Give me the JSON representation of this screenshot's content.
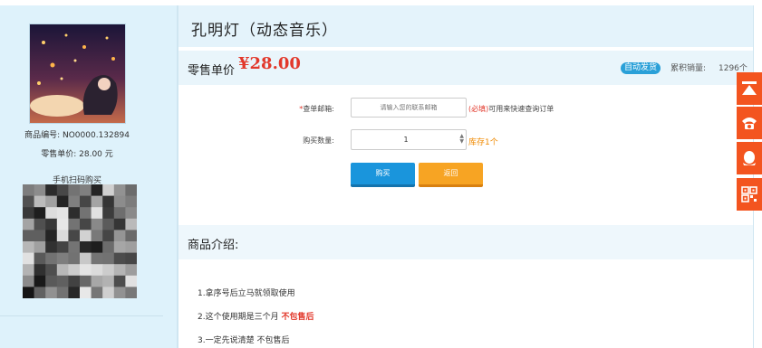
{
  "sidebar": {
    "sku_label": "商品编号:",
    "sku_value": "NO0000.132894",
    "price_label": "零售单价:",
    "price_value": "28.00 元",
    "scan_label": "手机扫码购买"
  },
  "product": {
    "title": "孔明灯（动态音乐）",
    "price_label": "零售单价",
    "price": "¥28.00",
    "auto_delivery_badge": "自动发货",
    "sales_label": "累积销量:",
    "sales_value": "1296个"
  },
  "form": {
    "email_label": "查单邮箱:",
    "email_placeholder": "请输入您的联系邮箱",
    "email_hint_required": "(必填)",
    "email_hint_text": "可用来快速查询订单",
    "qty_label": "购买数量:",
    "qty_value": "1",
    "stock_text": "库存1个",
    "buy_button": "购买",
    "back_button": "返回"
  },
  "intro": {
    "title": "商品介绍:",
    "lines": [
      {
        "text": "1.拿序号后立马就领取使用",
        "red": ""
      },
      {
        "text": "2.这个使用期是三个月",
        "red": "不包售后"
      },
      {
        "text": "3.一定先说清楚 不包售后",
        "red": ""
      }
    ]
  },
  "side_buttons": [
    {
      "icon": "back-to-top-icon"
    },
    {
      "icon": "phone-icon"
    },
    {
      "icon": "qq-penguin-icon"
    },
    {
      "icon": "qr-code-icon"
    }
  ],
  "colors": {
    "accent_blue": "#1a95dc",
    "price_red": "#e2382b",
    "side_orange": "#f3541f",
    "stock_orange": "#f08a00"
  }
}
